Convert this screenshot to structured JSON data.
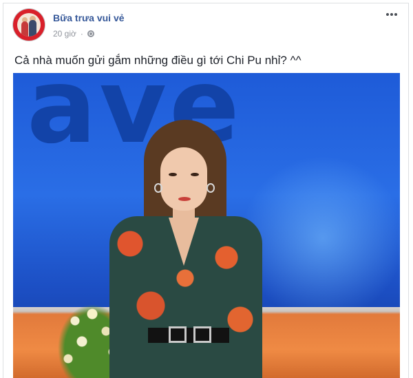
{
  "post": {
    "page_name": "Bữa trưa vui vẻ",
    "timestamp": "20 giờ",
    "separator": "·",
    "privacy_icon": "globe-icon",
    "more_icon": "more-options-icon",
    "text": "Cả nhà muốn gửi gắm những điều gì tới Chi Pu nhỉ? ^^"
  },
  "colors": {
    "page_name": "#365899",
    "meta_text": "#90949c",
    "body_text": "#1d2129"
  }
}
